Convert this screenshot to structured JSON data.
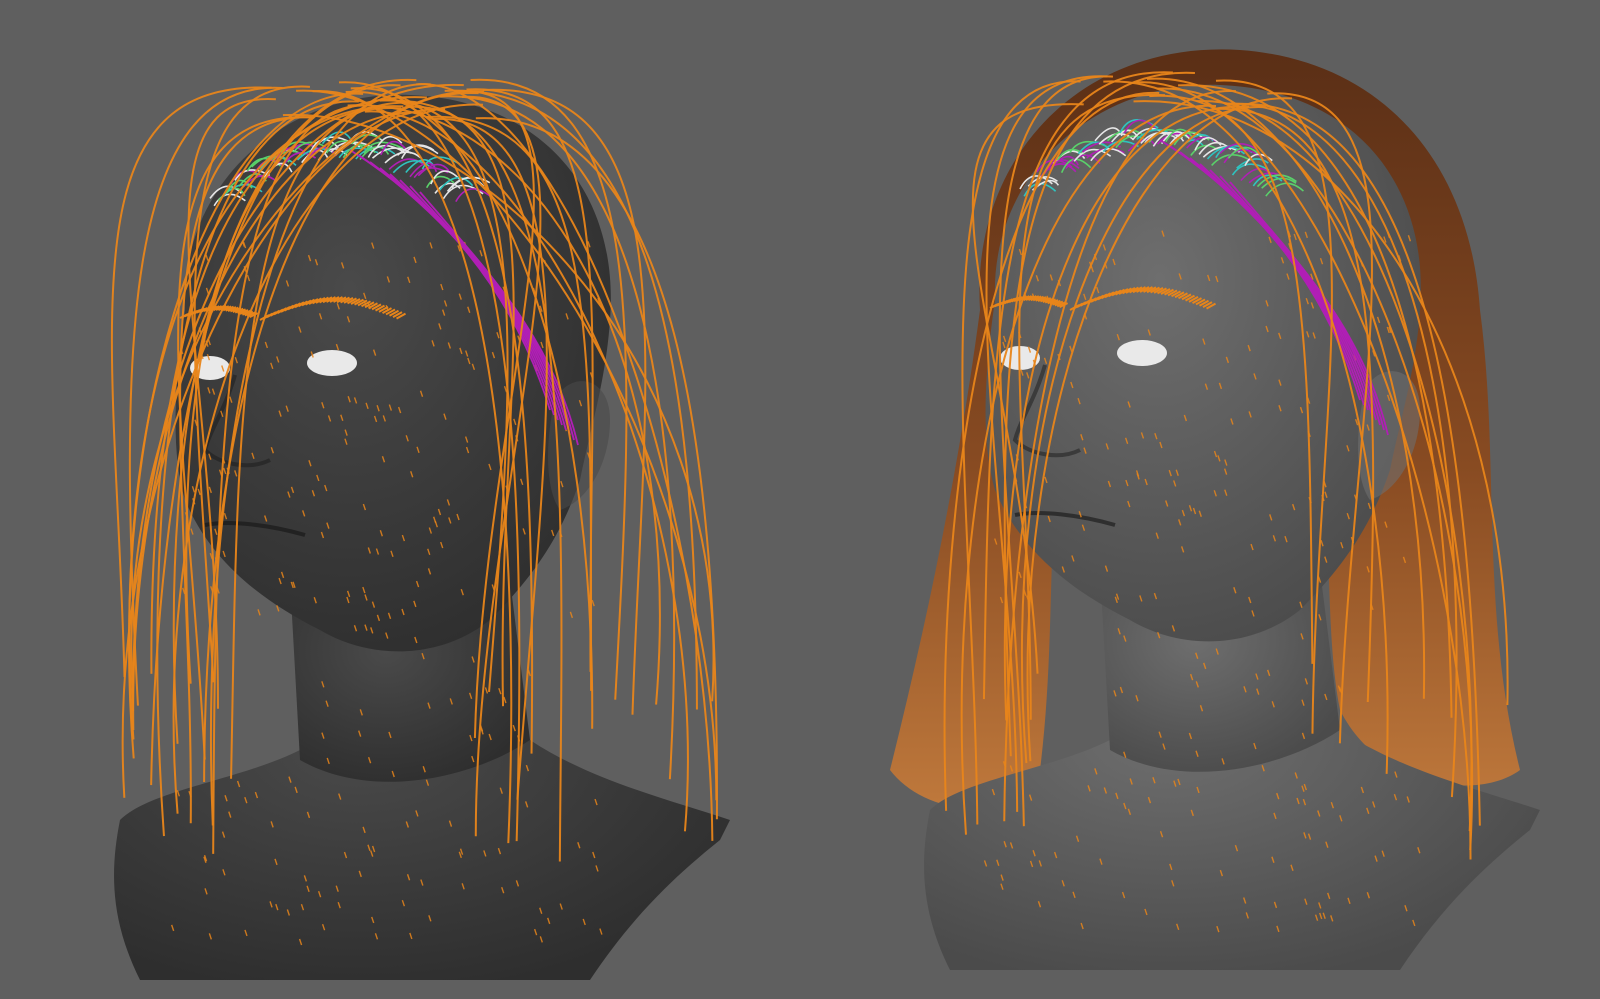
{
  "scene": {
    "background_color": "#5f5f5f",
    "panels": [
      {
        "name": "guide-curves-view",
        "skin_color": "#2e2e2e",
        "skin_highlight": "#4a4a4a",
        "show_rendered_hair": false
      },
      {
        "name": "rendered-hair-view",
        "skin_color": "#4b4b4b",
        "skin_highlight": "#6e6e6e",
        "show_rendered_hair": true
      }
    ],
    "colors": {
      "guide_orange": "#e8851a",
      "guide_magenta": "#b01fb5",
      "guide_cyan": "#2fc4c0",
      "guide_white": "#e6e6e6",
      "guide_green": "#5ad16a",
      "hair_dark": "#5a2c12",
      "hair_mid": "#8a4a1f",
      "hair_light": "#c47a3a",
      "eye_white": "#e9e9e9"
    }
  }
}
